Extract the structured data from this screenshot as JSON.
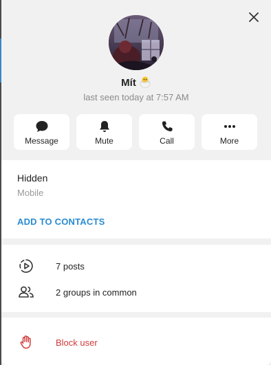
{
  "profile": {
    "name": "Mít",
    "status": "last seen today at 7:57 AM"
  },
  "actions": [
    {
      "label": "Message",
      "icon": "chat-bubble-icon"
    },
    {
      "label": "Mute",
      "icon": "bell-icon"
    },
    {
      "label": "Call",
      "icon": "phone-icon"
    },
    {
      "label": "More",
      "icon": "more-dots-icon"
    }
  ],
  "info": {
    "phone": "Hidden",
    "phone_label": "Mobile",
    "add_contact": "ADD TO CONTACTS"
  },
  "stats": {
    "posts": "7 posts",
    "groups": "2 groups in common"
  },
  "danger": {
    "block": "Block user"
  },
  "colors": {
    "accent": "#2a8bd1",
    "danger": "#d03b3b",
    "background": "#f1f1f1"
  }
}
